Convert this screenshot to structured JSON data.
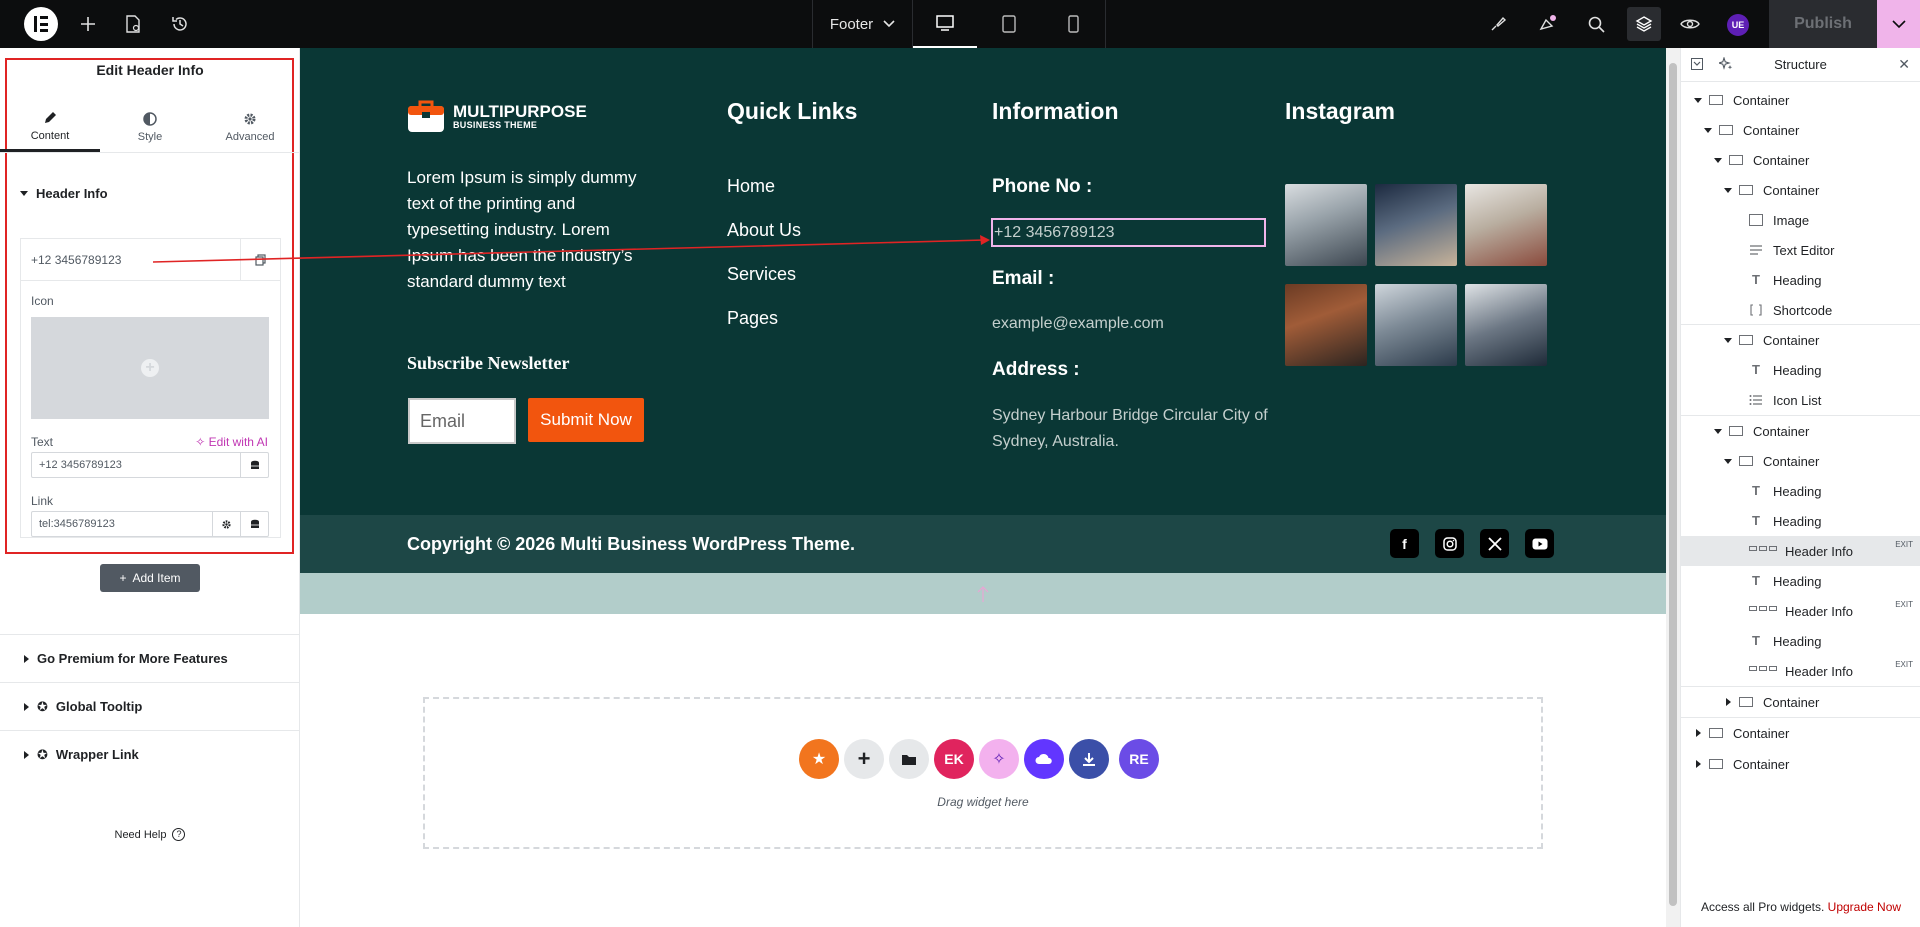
{
  "topbar": {
    "document_name": "Footer",
    "publish_label": "Publish",
    "user_initials": "UE"
  },
  "left_panel": {
    "title": "Edit Header Info",
    "tabs": [
      {
        "label": "Content",
        "icon": "pencil-icon",
        "active": true
      },
      {
        "label": "Style",
        "icon": "half-circle-icon",
        "active": false
      },
      {
        "label": "Advanced",
        "icon": "gear-icon",
        "active": false
      }
    ],
    "section_title": "Header Info",
    "repeater_item_title": "+12 3456789123",
    "icon_label": "Icon",
    "text_label": "Text",
    "edit_with_ai": "Edit with AI",
    "text_value": "+12 3456789123",
    "link_label": "Link",
    "link_value": "tel:3456789123",
    "add_item_label": "Add Item",
    "accordions": [
      "Go Premium for More Features",
      "Global Tooltip",
      "Wrapper Link"
    ],
    "need_help": "Need Help"
  },
  "canvas": {
    "brand_name": "MULTIPURPOSE",
    "brand_sub": "BUSINESS THEME",
    "about_text": "Lorem Ipsum is simply dummy text of the printing and typesetting industry. Lorem Ipsum has been the industry’s standard dummy text",
    "subscribe_title": "Subscribe Newsletter",
    "email_placeholder": "Email",
    "submit_label": "Submit Now",
    "quick_links_title": "Quick Links",
    "quick_links": [
      "Home",
      "About Us",
      "Services",
      "Pages"
    ],
    "information_title": "Information",
    "phone_label": "Phone No :",
    "phone_value": "+12 3456789123",
    "email_label": "Email :",
    "email_value": "example@example.com",
    "address_label": "Address :",
    "address_value": "Sydney Harbour Bridge Circular City of Sydney, Australia.",
    "instagram_title": "Instagram",
    "copyright": "Copyright © 2026 Multi Business WordPress Theme.",
    "socials": [
      "facebook-icon",
      "instagram-icon",
      "x-icon",
      "youtube-icon"
    ],
    "drag_text": "Drag widget here"
  },
  "structure": {
    "title": "Structure",
    "items": [
      {
        "label": "Container"
      },
      {
        "label": "Container"
      },
      {
        "label": "Container"
      },
      {
        "label": "Container"
      },
      {
        "label": "Image"
      },
      {
        "label": "Text Editor"
      },
      {
        "label": "Heading"
      },
      {
        "label": "Shortcode"
      },
      {
        "label": "Container"
      },
      {
        "label": "Heading"
      },
      {
        "label": "Icon List"
      },
      {
        "label": "Container"
      },
      {
        "label": "Container"
      },
      {
        "label": "Heading"
      },
      {
        "label": "Heading"
      },
      {
        "label": "Header Info",
        "tag": "EXIT"
      },
      {
        "label": "Heading"
      },
      {
        "label": "Header Info",
        "tag": "EXIT"
      },
      {
        "label": "Heading"
      },
      {
        "label": "Header Info",
        "tag": "EXIT"
      },
      {
        "label": "Container"
      },
      {
        "label": "Container"
      },
      {
        "label": "Container"
      }
    ],
    "footer_text": "Access all Pro widgets.",
    "upgrade_label": "Upgrade Now"
  },
  "colors": {
    "footer_bg": "#0a3735",
    "copyright_bg": "#1d4746",
    "accent_orange": "#f2550e",
    "highlight_red": "#e02424",
    "selection_pink": "#f0b4ea"
  }
}
